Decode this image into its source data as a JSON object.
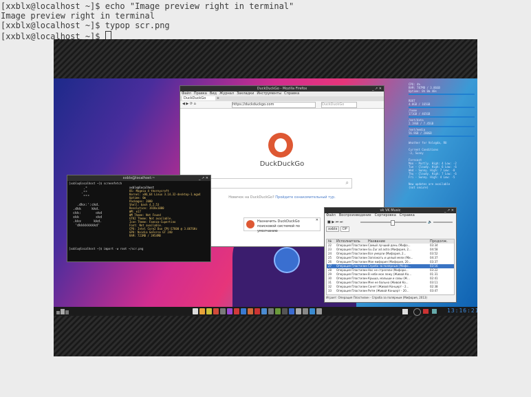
{
  "terminal": {
    "lines": [
      "[xxblx@localhost ~]$ echo \"Image preview right in terminal\"",
      "Image preview right in terminal",
      "[xxblx@localhost ~]$ typop scr.png",
      "[xxblx@localhost ~]$ "
    ]
  },
  "firefox": {
    "title": "DuckDuckGo - Mozilla Firefox",
    "menu": [
      "Файл",
      "Правка",
      "Вид",
      "Журнал",
      "Закладки",
      "Инструменты",
      "Справка"
    ],
    "tab_label": "DuckDuckGo",
    "url": "https://duckduckgo.com",
    "search_placeholder": "DuckDuckGo",
    "logo_text": "DuckDuckGo",
    "promo_text": "Новичок на DuckDuckGo?",
    "promo_link": "Пройдите ознакомительный тур.",
    "notice_line1": "Назначить DuckDuckGo",
    "notice_line2": "поисковой системой по умолчанию"
  },
  "xterm": {
    "title": "xxblx@localhost:~",
    "prompt1": "[xxblx@localhost ~]$ screenfetch",
    "prompt2": "[xxblx@localhost ~]$ import -w root ~/scr.png",
    "info": [
      "xxblx@localhost",
      "OS: Mageia 4 thornycroft",
      "Kernel: x86_64 Linux 3.14.32-desktop-1.mga4",
      "Uptime: 0m",
      "Packages: 2080",
      "Shell: bash 4.2.53",
      "Resolution: 1920x1080",
      "WM: e17",
      "WM Theme: Not Found",
      "GTK2 Theme: Not available.",
      "Icon Theme: Faenza-Cupertino",
      "Font: Not available.",
      "CPU: Intel Core2 Duo CPU E7600 @ 3.067GHz",
      "GPU: Nvidia GeForce GT 240",
      "RAM: 721MB / 3954MB"
    ]
  },
  "player": {
    "title": "vk VK Music",
    "menu": [
      "Файл",
      "Воспроизведение",
      "Сортировка",
      "Справка"
    ],
    "tabs": [
      "xxblx",
      "DP"
    ],
    "columns": [
      "№",
      "Исполнитель",
      "Название",
      "Продолж."
    ],
    "rows": [
      [
        "22",
        "Операция Пластилин",
        "Самый лучший день (Мифо...",
        "03:34"
      ],
      [
        "23",
        "Операция Пластилин",
        "Gu Zur ad astra (Мифория, 2...",
        "04:58"
      ],
      [
        "24",
        "Операция Пластилин",
        "Все умерли (Мифория, 2...",
        "03:52"
      ],
      [
        "25",
        "Операция Пластилин",
        "Заплакать и целый мели (Ми...",
        "04:37"
      ],
      [
        "26",
        "Операция Пластилин",
        "Мое мифория (Мифория, 20...",
        "03:37"
      ],
      [
        "27",
        "Операция Пластилин",
        "Спроба за полярным (Мифо...",
        "03:16"
      ],
      [
        "28",
        "Операция Пластилин",
        "Нас не стреляли (Мифори...",
        "03:22"
      ],
      [
        "29",
        "Операция Пластилин",
        "В небе мое лежу (Живой Ко...",
        "01:31"
      ],
      [
        "30",
        "Операция Пластилин",
        "Крыша, малыши и совы (Ж...",
        "02:41"
      ],
      [
        "31",
        "Операция Пластилин",
        "Мне не больно (Живой Ко...",
        "03:11"
      ],
      [
        "32",
        "Операция Пластилин",
        "Сонет (Живой Концерт - 2...",
        "02:38"
      ],
      [
        "33",
        "Операция Пластилин",
        "Ритм (Живой Концерт - 20...",
        "03:47"
      ]
    ],
    "status": "Играет: Операция Пластилин - Спроба за полярным (Мифория, 2013)"
  },
  "conky": {
    "lines": [
      "CPU: 4%",
      "RAM: 787MB / 3.86GB",
      "Uptime: 0h 0m 40s",
      "",
      "ROOT",
      "4.0GB / 165GB",
      "/home",
      "171GB / 465GB",
      "/mnt/data",
      "2.19GB / 7.45GB",
      "/mnt/media",
      "56.9GB / 200GB",
      "",
      "Weather for Vologda, RU",
      "",
      "Current Conditions",
      "-3, Sunny",
      "",
      "Forecast",
      "Mon - Partly. High: 4 Low: -2",
      "Tue - Cloudy. High: 6 Low: -6",
      "Wed - Sunny. High: 7 Low: -8",
      "Thu - Cloudy. High: 7 Low: -6",
      "Fri - Sunny. High: 4 Low: -5",
      "",
      "New updates are available",
      "(not secure)"
    ]
  },
  "clock": "13:16:21",
  "colors": {
    "accent": "#1f7fd0",
    "ddg": "#de5833",
    "selection": "#3a74c4"
  }
}
